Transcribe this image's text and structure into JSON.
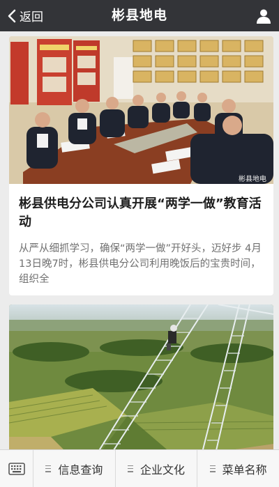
{
  "header": {
    "back_label": "返回",
    "title": "彬县地电",
    "back_icon": "chevron-left-icon",
    "user_icon": "user-icon",
    "bg_color": "#333438"
  },
  "feed": {
    "articles": [
      {
        "title": "彬县供电分公司认真开展“两学一做”教育活动",
        "summary": "从严从细抓学习，确保“两学一做”开好头，迈好步 4月13日晚7时，彬县供电分公司利用晚饭后的宝贵时间，组织全",
        "watermark": "彬县地电"
      },
      {
        "title": "",
        "summary": ""
      }
    ]
  },
  "menu": {
    "keyboard_icon": "keyboard-icon",
    "items": [
      {
        "label": "信息查询"
      },
      {
        "label": "企业文化"
      },
      {
        "label": "菜单名称"
      }
    ]
  }
}
